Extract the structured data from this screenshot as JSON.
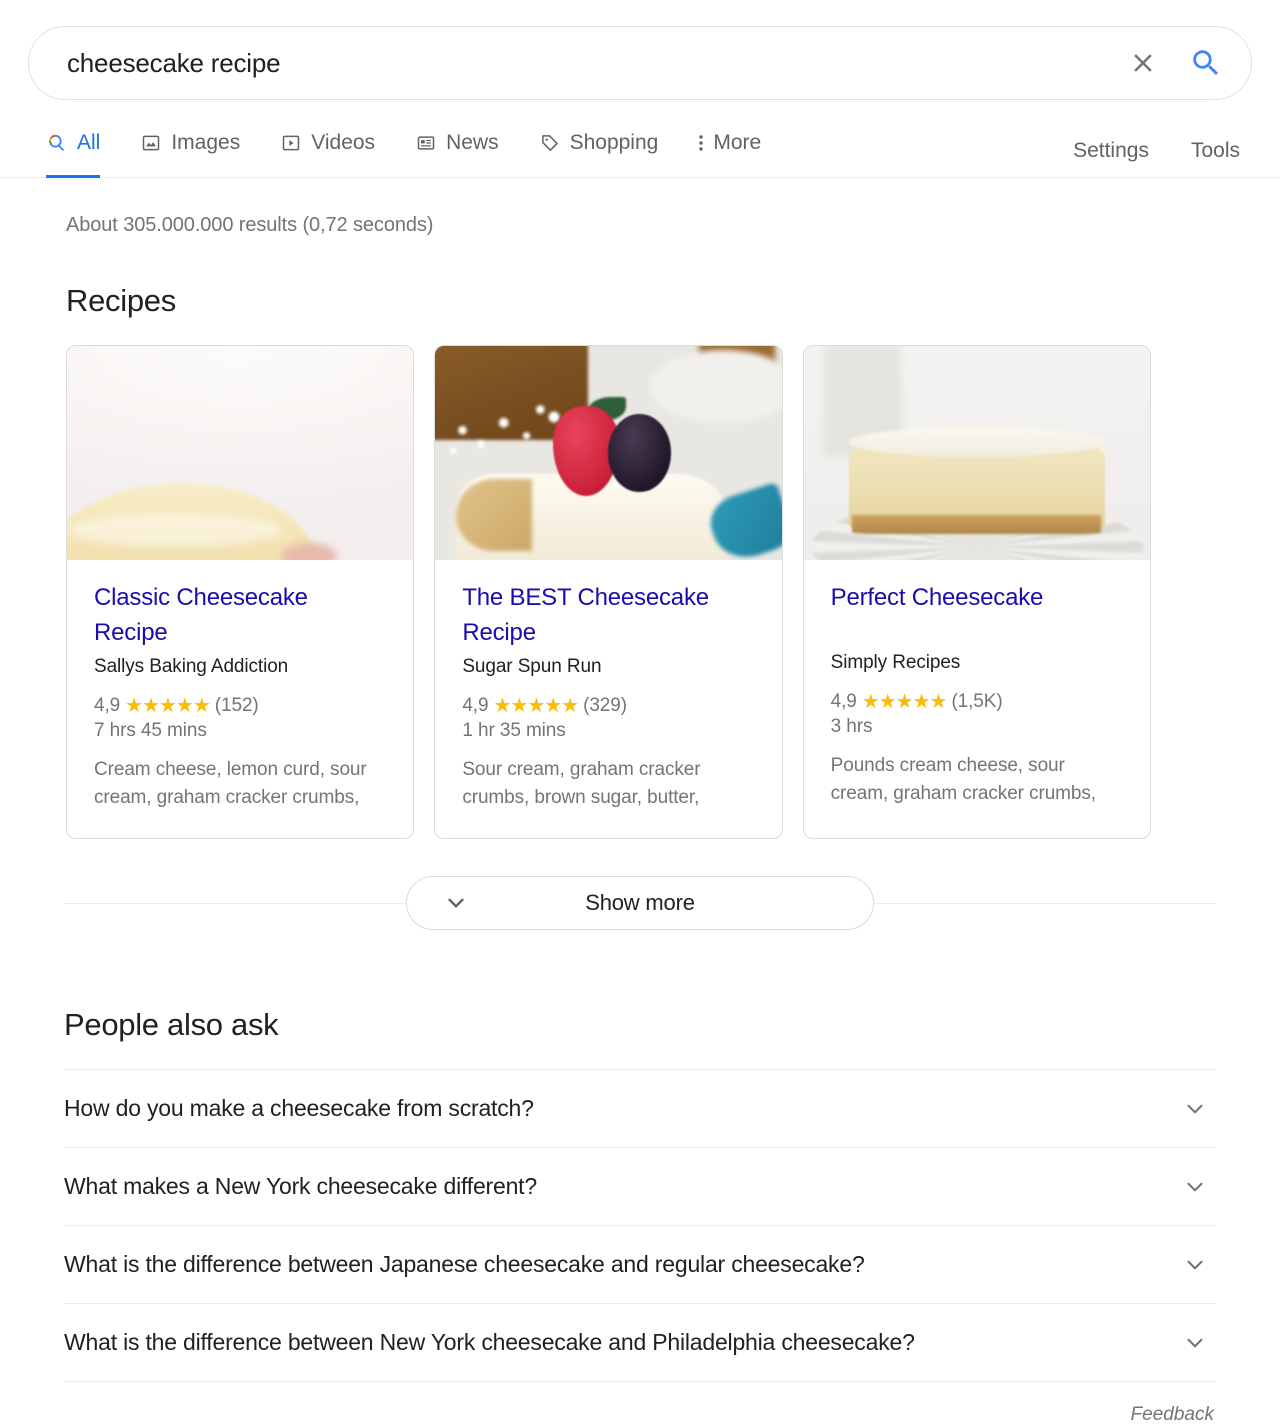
{
  "search": {
    "query": "cheesecake recipe",
    "placeholder": "Search",
    "clear_label": "Clear",
    "submit_label": "Google Search"
  },
  "nav": {
    "tabs": [
      {
        "label": "All",
        "icon": "google-search-icon",
        "active": true
      },
      {
        "label": "Images",
        "icon": "image-icon",
        "active": false
      },
      {
        "label": "Videos",
        "icon": "video-icon",
        "active": false
      },
      {
        "label": "News",
        "icon": "news-icon",
        "active": false
      },
      {
        "label": "Shopping",
        "icon": "tag-icon",
        "active": false
      },
      {
        "label": "More",
        "icon": "more-vert-icon",
        "active": false
      }
    ],
    "right": [
      {
        "label": "Settings"
      },
      {
        "label": "Tools"
      }
    ]
  },
  "result_stats": "About 305.000.000 results (0,72 seconds)",
  "recipes": {
    "heading": "Recipes",
    "cards": [
      {
        "title": "Classic Cheesecake Recipe",
        "source": "Sallys Baking Addiction",
        "rating": "4,9",
        "stars": "★★★★★",
        "reviews": "(152)",
        "time": "7 hrs 45 mins",
        "ingredients": "Cream cheese, lemon curd, sour cream, graham cracker crumbs,",
        "image": "plain-cheesecake-closeup"
      },
      {
        "title": "The BEST Cheesecake Recipe",
        "source": "Sugar Spun Run",
        "rating": "4,9",
        "stars": "★★★★★",
        "reviews": "(329)",
        "time": "1 hr 35 mins",
        "ingredients": "Sour cream, graham cracker crumbs, brown sugar, butter,",
        "image": "cheesecake-slice-with-berries"
      },
      {
        "title": "Perfect Cheesecake",
        "source": "Simply Recipes",
        "rating": "4,9",
        "stars": "★★★★★",
        "reviews": "(1,5K)",
        "time": "3 hrs",
        "ingredients": "Pounds cream cheese, sour cream, graham cracker crumbs,",
        "image": "whole-cheesecake-on-plate"
      }
    ],
    "show_more_label": "Show more"
  },
  "people_also_ask": {
    "heading": "People also ask",
    "questions": [
      "How do you make a cheesecake from scratch?",
      "What makes a New York cheesecake different?",
      "What is the difference between Japanese cheesecake and regular cheesecake?",
      "What is the difference between New York cheesecake and Philadelphia cheesecake?"
    ]
  },
  "feedback_label": "Feedback",
  "colors": {
    "link_blue": "#1a0dab",
    "accent_blue": "#1a73e8",
    "star_gold": "#fbbc04",
    "text_gray": "#70757a",
    "text_dark": "#202124",
    "border": "#dadce0"
  }
}
